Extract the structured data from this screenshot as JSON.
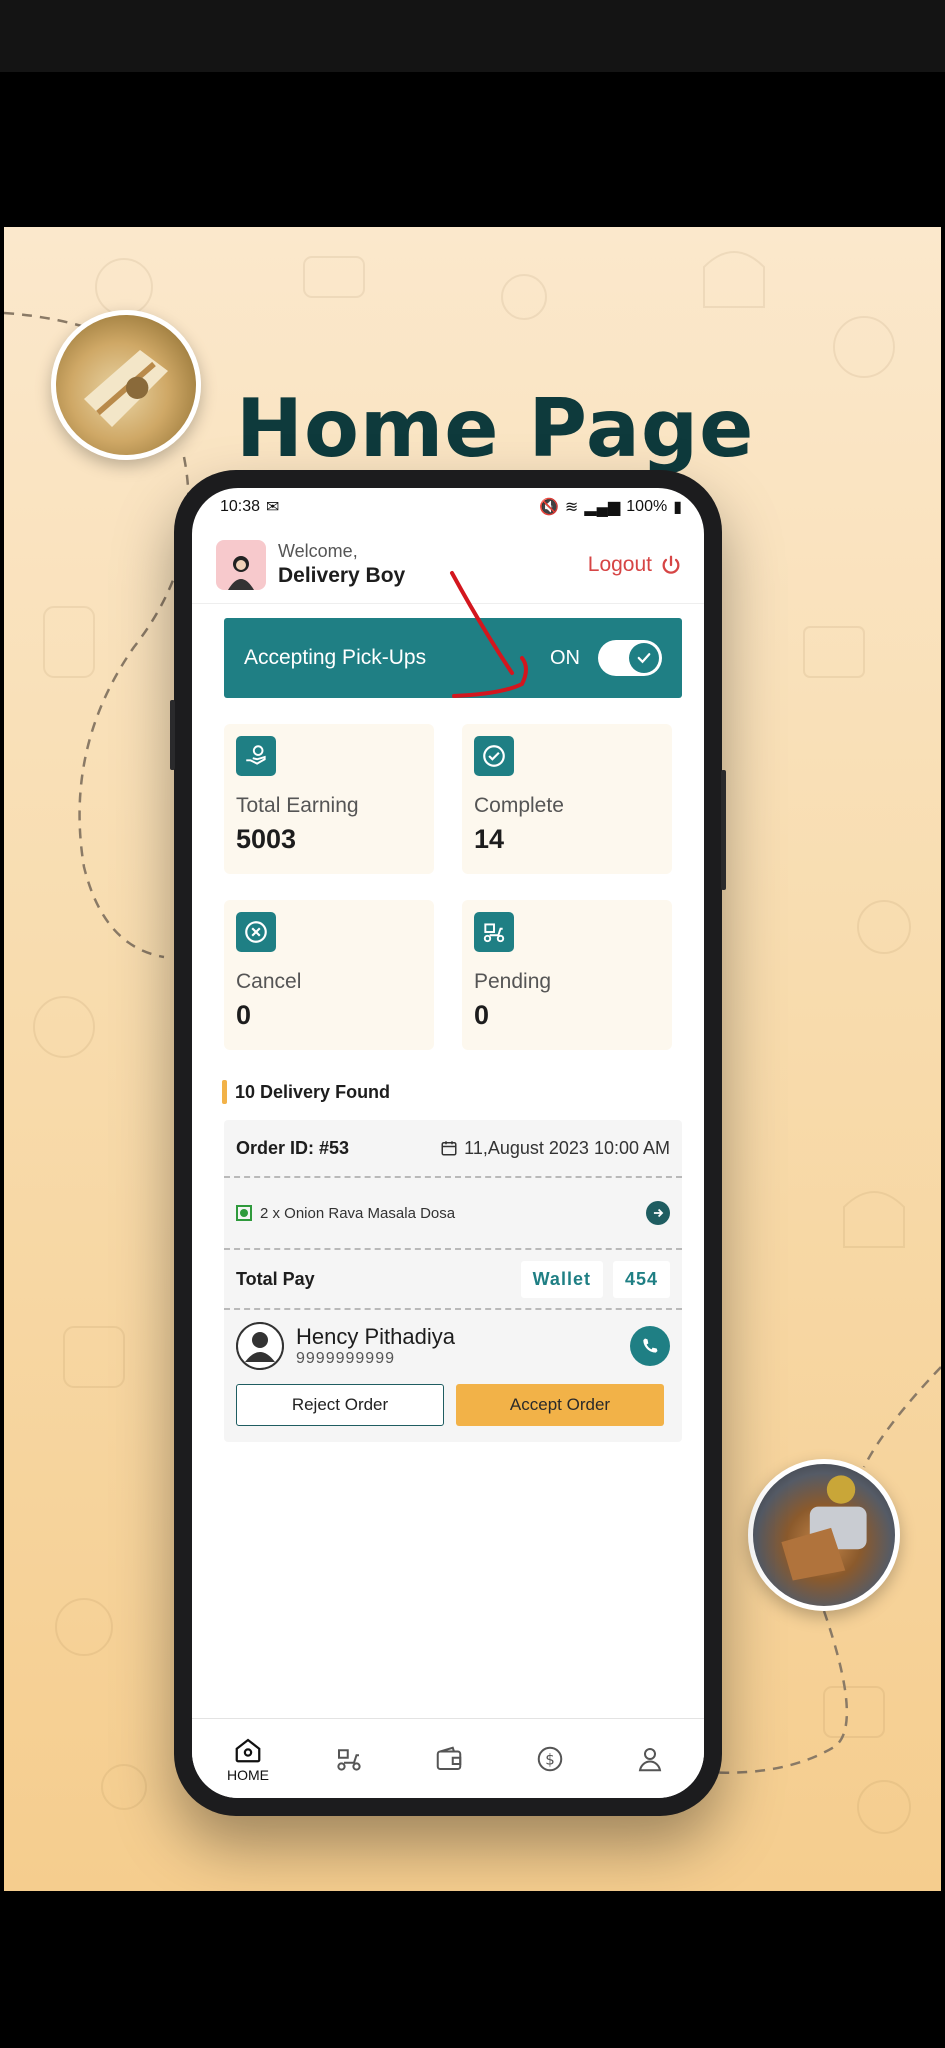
{
  "poster": {
    "title": "Home Page"
  },
  "status_bar": {
    "time": "10:38",
    "battery": "100%"
  },
  "header": {
    "welcome": "Welcome,",
    "name": "Delivery Boy",
    "logout": "Logout"
  },
  "pickup": {
    "label": "Accepting Pick-Ups",
    "state": "ON",
    "enabled": true
  },
  "stats": [
    {
      "label": "Total Earning",
      "value": "5003",
      "icon": "earning-icon"
    },
    {
      "label": "Complete",
      "value": "14",
      "icon": "check-circle-icon"
    },
    {
      "label": "Cancel",
      "value": "0",
      "icon": "cancel-circle-icon"
    },
    {
      "label": "Pending",
      "value": "0",
      "icon": "delivery-scooter-icon"
    }
  ],
  "deliveries": {
    "found_text": "10 Delivery Found"
  },
  "order": {
    "id": "Order ID: #53",
    "date": "11,August 2023 10:00 AM",
    "item": "2 x Onion Rava Masala Dosa",
    "total_label": "Total Pay",
    "payment_method": "Wallet",
    "amount": "454",
    "customer_name": "Hency Pithadiya",
    "customer_phone": "9999999999",
    "reject_label": "Reject Order",
    "accept_label": "Accept Order"
  },
  "bottom_nav": {
    "home_label": "HOME",
    "items": [
      "home-icon",
      "scooter-icon",
      "wallet-icon",
      "dollar-icon",
      "profile-icon"
    ]
  },
  "colors": {
    "primary": "#1f7f84",
    "accent": "#f2b248",
    "logout": "#d64545",
    "title": "#0e3a3c"
  }
}
